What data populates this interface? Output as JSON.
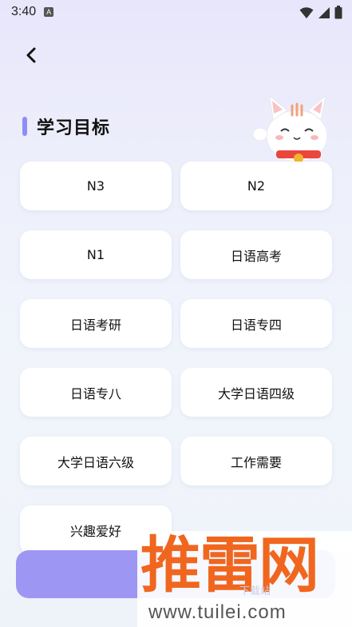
{
  "status_bar": {
    "time": "3:40",
    "indicator": "A"
  },
  "header": {
    "back_icon": "chevron-left-icon"
  },
  "section": {
    "title": "学习目标"
  },
  "options": [
    "N3",
    "N2",
    "N1",
    "日语高考",
    "日语考研",
    "日语专四",
    "日语专八",
    "大学日语四级",
    "大学日语六级",
    "工作需要",
    "兴趣爱好"
  ],
  "watermark": {
    "big": "推雷网",
    "sub": "下载站",
    "url": "www.tuilei.com"
  },
  "colors": {
    "accent": "#8f8df5",
    "button": "#9d97f3",
    "watermark": "#f0661e"
  }
}
